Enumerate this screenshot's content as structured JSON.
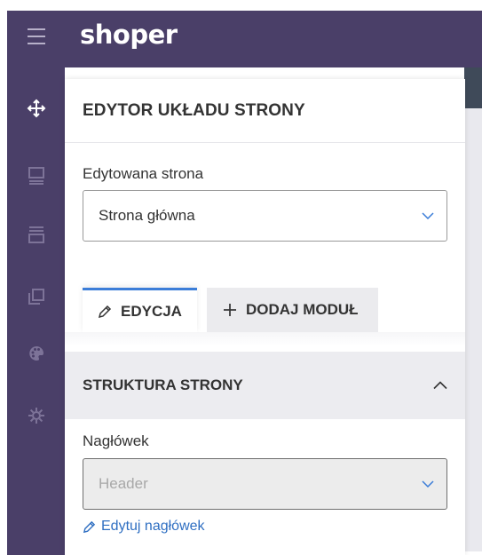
{
  "app": {
    "logo": "shoper"
  },
  "sidebar": {
    "items": [
      {
        "icon": "menu-icon"
      },
      {
        "icon": "move-arrows-icon",
        "active": true
      },
      {
        "icon": "layout-icon"
      },
      {
        "icon": "rows-icon"
      },
      {
        "icon": "pages-icon"
      },
      {
        "icon": "palette-icon"
      },
      {
        "icon": "gear-icon"
      }
    ]
  },
  "panel": {
    "title": "EDYTOR UKŁADU STRONY",
    "page_label": "Edytowana strona",
    "page_value": "Strona główna",
    "tabs": [
      {
        "label": "EDYCJA",
        "icon": "pencil-icon",
        "active": true
      },
      {
        "label": "DODAJ MODUŁ",
        "icon": "plus-icon",
        "active": false
      }
    ],
    "section_title": "STRUKTURA STRONY",
    "header_label": "Nagłówek",
    "header_value": "Header",
    "edit_header_link": "Edytuj nagłówek"
  },
  "colors": {
    "sidebar_bg": "#4a3f68",
    "accent": "#3b7dd8",
    "link": "#2f6fc2"
  }
}
